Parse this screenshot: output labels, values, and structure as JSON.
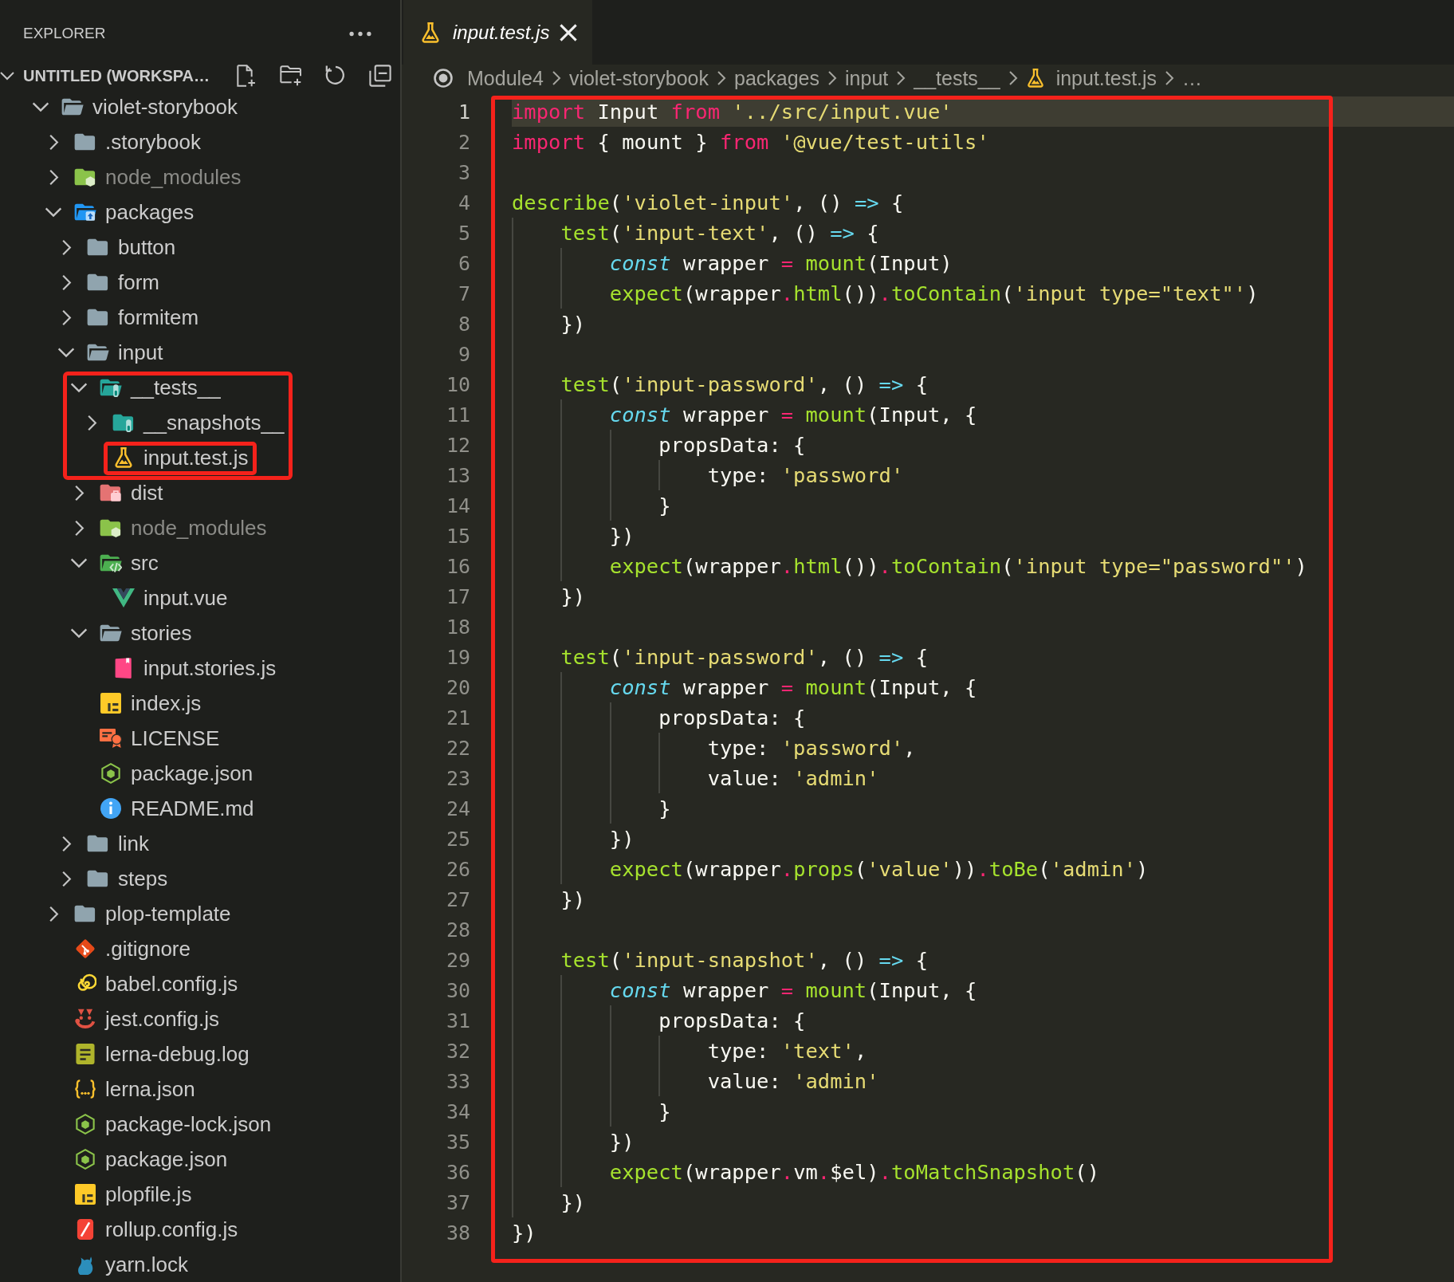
{
  "sidebar": {
    "title": "EXPLORER",
    "workspace": {
      "title": "UNTITLED (WORKSPA…",
      "expanded": true
    },
    "tree": [
      {
        "label": "violet-storybook",
        "kind": "folder",
        "expanded": true,
        "dimmed": false,
        "highlighted": false,
        "children": [
          {
            "label": ".storybook",
            "kind": "folder",
            "expanded": false,
            "dimmed": false,
            "highlighted": false
          },
          {
            "label": "node_modules",
            "kind": "modules",
            "expanded": false,
            "dimmed": true,
            "highlighted": false
          },
          {
            "label": "packages",
            "kind": "packages",
            "expanded": true,
            "dimmed": false,
            "highlighted": false,
            "children": [
              {
                "label": "button",
                "kind": "folder",
                "expanded": false,
                "dimmed": false,
                "highlighted": false
              },
              {
                "label": "form",
                "kind": "folder",
                "expanded": false,
                "dimmed": false,
                "highlighted": false
              },
              {
                "label": "formitem",
                "kind": "folder",
                "expanded": false,
                "dimmed": false,
                "highlighted": false
              },
              {
                "label": "input",
                "kind": "folder",
                "expanded": true,
                "dimmed": false,
                "highlighted": false,
                "children": [
                  {
                    "label": "__tests__",
                    "kind": "tests",
                    "expanded": true,
                    "dimmed": false,
                    "highlighted": true,
                    "children": [
                      {
                        "label": "__snapshots__",
                        "kind": "tests",
                        "expanded": false,
                        "dimmed": false,
                        "highlighted": false
                      },
                      {
                        "label": "input.test.js",
                        "kind": "test",
                        "dimmed": false,
                        "highlighted": true
                      }
                    ]
                  },
                  {
                    "label": "dist",
                    "kind": "dist",
                    "expanded": false,
                    "dimmed": false,
                    "highlighted": false
                  },
                  {
                    "label": "node_modules",
                    "kind": "modules",
                    "expanded": false,
                    "dimmed": true,
                    "highlighted": false
                  },
                  {
                    "label": "src",
                    "kind": "src",
                    "expanded": true,
                    "dimmed": false,
                    "highlighted": false,
                    "children": [
                      {
                        "label": "input.vue",
                        "kind": "vue",
                        "dimmed": false,
                        "highlighted": false
                      }
                    ]
                  },
                  {
                    "label": "stories",
                    "kind": "folder",
                    "expanded": true,
                    "dimmed": false,
                    "highlighted": false,
                    "children": [
                      {
                        "label": "input.stories.js",
                        "kind": "story",
                        "dimmed": false,
                        "highlighted": false
                      }
                    ]
                  },
                  {
                    "label": "index.js",
                    "kind": "js",
                    "dimmed": false,
                    "highlighted": false
                  },
                  {
                    "label": "LICENSE",
                    "kind": "license",
                    "dimmed": false,
                    "highlighted": false
                  },
                  {
                    "label": "package.json",
                    "kind": "node",
                    "dimmed": false,
                    "highlighted": false
                  },
                  {
                    "label": "README.md",
                    "kind": "info",
                    "dimmed": false,
                    "highlighted": false
                  }
                ]
              },
              {
                "label": "link",
                "kind": "folder",
                "expanded": false,
                "dimmed": false,
                "highlighted": false
              },
              {
                "label": "steps",
                "kind": "folder",
                "expanded": false,
                "dimmed": false,
                "highlighted": false
              }
            ]
          },
          {
            "label": "plop-template",
            "kind": "folder",
            "expanded": false,
            "dimmed": false,
            "highlighted": false
          },
          {
            "label": ".gitignore",
            "kind": "git",
            "dimmed": false,
            "highlighted": false
          },
          {
            "label": "babel.config.js",
            "kind": "babel",
            "dimmed": false,
            "highlighted": false
          },
          {
            "label": "jest.config.js",
            "kind": "jest",
            "dimmed": false,
            "highlighted": false
          },
          {
            "label": "lerna-debug.log",
            "kind": "log",
            "dimmed": false,
            "highlighted": false
          },
          {
            "label": "lerna.json",
            "kind": "json",
            "dimmed": false,
            "highlighted": false
          },
          {
            "label": "package-lock.json",
            "kind": "node",
            "dimmed": false,
            "highlighted": false
          },
          {
            "label": "package.json",
            "kind": "node",
            "dimmed": false,
            "highlighted": false
          },
          {
            "label": "plopfile.js",
            "kind": "js",
            "dimmed": false,
            "highlighted": false
          },
          {
            "label": "rollup.config.js",
            "kind": "rollup",
            "dimmed": false,
            "highlighted": false
          },
          {
            "label": "yarn.lock",
            "kind": "yarn",
            "dimmed": false,
            "highlighted": false
          }
        ]
      }
    ]
  },
  "editor": {
    "tabs": [
      {
        "label": "input.test.js",
        "kind": "test",
        "selected": true,
        "preview": true
      }
    ],
    "breadcrumbs": [
      {
        "label": "Module4",
        "kind": "root"
      },
      {
        "label": "violet-storybook",
        "kind": "folder"
      },
      {
        "label": "packages",
        "kind": "folder"
      },
      {
        "label": "input",
        "kind": "folder"
      },
      {
        "label": "__tests__",
        "kind": "folder"
      },
      {
        "label": "input.test.js",
        "kind": "test"
      },
      {
        "label": "…",
        "kind": "symbol"
      }
    ],
    "highlighted": true,
    "lines": [
      {
        "number": "1",
        "current": true,
        "tokens": [
          {
            "kind": "keyword",
            "text": "import"
          },
          {
            "kind": "plain",
            "text": " Input "
          },
          {
            "kind": "keyword",
            "text": "from"
          },
          {
            "kind": "string",
            "text": " '../src/input.vue'"
          }
        ]
      },
      {
        "number": "2",
        "current": false,
        "tokens": [
          {
            "kind": "keyword",
            "text": "import"
          },
          {
            "kind": "plain",
            "text": " { mount } "
          },
          {
            "kind": "keyword",
            "text": "from"
          },
          {
            "kind": "string",
            "text": " '@vue/test-utils'"
          }
        ]
      },
      {
        "number": "3",
        "current": false
      },
      {
        "number": "4",
        "current": false,
        "tokens": [
          {
            "kind": "function",
            "text": "describe"
          },
          {
            "kind": "plain",
            "text": "("
          },
          {
            "kind": "string",
            "text": "'violet-input'"
          },
          {
            "kind": "plain",
            "text": ", () "
          },
          {
            "kind": "arrow",
            "text": "=>"
          },
          {
            "kind": "plain",
            "text": " {"
          }
        ]
      },
      {
        "number": "5",
        "current": false,
        "tokens": [
          {
            "kind": "function",
            "text": "    test"
          },
          {
            "kind": "plain",
            "text": "("
          },
          {
            "kind": "string",
            "text": "'input-text'"
          },
          {
            "kind": "plain",
            "text": ", () "
          },
          {
            "kind": "arrow",
            "text": "=>"
          },
          {
            "kind": "plain",
            "text": " {"
          }
        ]
      },
      {
        "number": "6",
        "current": false,
        "tokens": [
          {
            "kind": "storage",
            "text": "        const"
          },
          {
            "kind": "plain",
            "text": " wrapper "
          },
          {
            "kind": "operator",
            "text": "="
          },
          {
            "kind": "function",
            "text": " mount"
          },
          {
            "kind": "plain",
            "text": "(Input)"
          }
        ]
      },
      {
        "number": "7",
        "current": false,
        "tokens": [
          {
            "kind": "function",
            "text": "        expect"
          },
          {
            "kind": "plain",
            "text": "(wrapper"
          },
          {
            "kind": "operator",
            "text": "."
          },
          {
            "kind": "function",
            "text": "html"
          },
          {
            "kind": "plain",
            "text": "())"
          },
          {
            "kind": "operator",
            "text": "."
          },
          {
            "kind": "function",
            "text": "toContain"
          },
          {
            "kind": "plain",
            "text": "("
          },
          {
            "kind": "string",
            "text": "'input type=\"text\"'"
          },
          {
            "kind": "plain",
            "text": ")"
          }
        ]
      },
      {
        "number": "8",
        "current": false,
        "tokens": [
          {
            "kind": "plain",
            "text": "    })"
          }
        ]
      },
      {
        "number": "9",
        "current": false
      },
      {
        "number": "10",
        "current": false,
        "tokens": [
          {
            "kind": "function",
            "text": "    test"
          },
          {
            "kind": "plain",
            "text": "("
          },
          {
            "kind": "string",
            "text": "'input-password'"
          },
          {
            "kind": "plain",
            "text": ", () "
          },
          {
            "kind": "arrow",
            "text": "=>"
          },
          {
            "kind": "plain",
            "text": " {"
          }
        ]
      },
      {
        "number": "11",
        "current": false,
        "tokens": [
          {
            "kind": "storage",
            "text": "        const"
          },
          {
            "kind": "plain",
            "text": " wrapper "
          },
          {
            "kind": "operator",
            "text": "="
          },
          {
            "kind": "function",
            "text": " mount"
          },
          {
            "kind": "plain",
            "text": "(Input, {"
          }
        ]
      },
      {
        "number": "12",
        "current": false,
        "tokens": [
          {
            "kind": "plain",
            "text": "            propsData: {"
          }
        ]
      },
      {
        "number": "13",
        "current": false,
        "tokens": [
          {
            "kind": "plain",
            "text": "                type: "
          },
          {
            "kind": "string",
            "text": "'password'"
          }
        ]
      },
      {
        "number": "14",
        "current": false,
        "tokens": [
          {
            "kind": "plain",
            "text": "            }"
          }
        ]
      },
      {
        "number": "15",
        "current": false,
        "tokens": [
          {
            "kind": "plain",
            "text": "        })"
          }
        ]
      },
      {
        "number": "16",
        "current": false,
        "tokens": [
          {
            "kind": "function",
            "text": "        expect"
          },
          {
            "kind": "plain",
            "text": "(wrapper"
          },
          {
            "kind": "operator",
            "text": "."
          },
          {
            "kind": "function",
            "text": "html"
          },
          {
            "kind": "plain",
            "text": "())"
          },
          {
            "kind": "operator",
            "text": "."
          },
          {
            "kind": "function",
            "text": "toContain"
          },
          {
            "kind": "plain",
            "text": "("
          },
          {
            "kind": "string",
            "text": "'input type=\"password\"'"
          },
          {
            "kind": "plain",
            "text": ")"
          }
        ]
      },
      {
        "number": "17",
        "current": false,
        "tokens": [
          {
            "kind": "plain",
            "text": "    })"
          }
        ]
      },
      {
        "number": "18",
        "current": false
      },
      {
        "number": "19",
        "current": false,
        "tokens": [
          {
            "kind": "function",
            "text": "    test"
          },
          {
            "kind": "plain",
            "text": "("
          },
          {
            "kind": "string",
            "text": "'input-password'"
          },
          {
            "kind": "plain",
            "text": ", () "
          },
          {
            "kind": "arrow",
            "text": "=>"
          },
          {
            "kind": "plain",
            "text": " {"
          }
        ]
      },
      {
        "number": "20",
        "current": false,
        "tokens": [
          {
            "kind": "storage",
            "text": "        const"
          },
          {
            "kind": "plain",
            "text": " wrapper "
          },
          {
            "kind": "operator",
            "text": "="
          },
          {
            "kind": "function",
            "text": " mount"
          },
          {
            "kind": "plain",
            "text": "(Input, {"
          }
        ]
      },
      {
        "number": "21",
        "current": false,
        "tokens": [
          {
            "kind": "plain",
            "text": "            propsData: {"
          }
        ]
      },
      {
        "number": "22",
        "current": false,
        "tokens": [
          {
            "kind": "plain",
            "text": "                type: "
          },
          {
            "kind": "string",
            "text": "'password'"
          },
          {
            "kind": "plain",
            "text": ","
          }
        ]
      },
      {
        "number": "23",
        "current": false,
        "tokens": [
          {
            "kind": "plain",
            "text": "                value: "
          },
          {
            "kind": "string",
            "text": "'admin'"
          }
        ]
      },
      {
        "number": "24",
        "current": false,
        "tokens": [
          {
            "kind": "plain",
            "text": "            }"
          }
        ]
      },
      {
        "number": "25",
        "current": false,
        "tokens": [
          {
            "kind": "plain",
            "text": "        })"
          }
        ]
      },
      {
        "number": "26",
        "current": false,
        "tokens": [
          {
            "kind": "function",
            "text": "        expect"
          },
          {
            "kind": "plain",
            "text": "(wrapper"
          },
          {
            "kind": "operator",
            "text": "."
          },
          {
            "kind": "function",
            "text": "props"
          },
          {
            "kind": "plain",
            "text": "("
          },
          {
            "kind": "string",
            "text": "'value'"
          },
          {
            "kind": "plain",
            "text": "))"
          },
          {
            "kind": "operator",
            "text": "."
          },
          {
            "kind": "function",
            "text": "toBe"
          },
          {
            "kind": "plain",
            "text": "("
          },
          {
            "kind": "string",
            "text": "'admin'"
          },
          {
            "kind": "plain",
            "text": ")"
          }
        ]
      },
      {
        "number": "27",
        "current": false,
        "tokens": [
          {
            "kind": "plain",
            "text": "    })"
          }
        ]
      },
      {
        "number": "28",
        "current": false
      },
      {
        "number": "29",
        "current": false,
        "tokens": [
          {
            "kind": "function",
            "text": "    test"
          },
          {
            "kind": "plain",
            "text": "("
          },
          {
            "kind": "string",
            "text": "'input-snapshot'"
          },
          {
            "kind": "plain",
            "text": ", () "
          },
          {
            "kind": "arrow",
            "text": "=>"
          },
          {
            "kind": "plain",
            "text": " {"
          }
        ]
      },
      {
        "number": "30",
        "current": false,
        "tokens": [
          {
            "kind": "storage",
            "text": "        const"
          },
          {
            "kind": "plain",
            "text": " wrapper "
          },
          {
            "kind": "operator",
            "text": "="
          },
          {
            "kind": "function",
            "text": " mount"
          },
          {
            "kind": "plain",
            "text": "(Input, {"
          }
        ]
      },
      {
        "number": "31",
        "current": false,
        "tokens": [
          {
            "kind": "plain",
            "text": "            propsData: {"
          }
        ]
      },
      {
        "number": "32",
        "current": false,
        "tokens": [
          {
            "kind": "plain",
            "text": "                type: "
          },
          {
            "kind": "string",
            "text": "'text'"
          },
          {
            "kind": "plain",
            "text": ","
          }
        ]
      },
      {
        "number": "33",
        "current": false,
        "tokens": [
          {
            "kind": "plain",
            "text": "                value: "
          },
          {
            "kind": "string",
            "text": "'admin'"
          }
        ]
      },
      {
        "number": "34",
        "current": false,
        "tokens": [
          {
            "kind": "plain",
            "text": "            }"
          }
        ]
      },
      {
        "number": "35",
        "current": false,
        "tokens": [
          {
            "kind": "plain",
            "text": "        })"
          }
        ]
      },
      {
        "number": "36",
        "current": false,
        "tokens": [
          {
            "kind": "function",
            "text": "        expect"
          },
          {
            "kind": "plain",
            "text": "(wrapper"
          },
          {
            "kind": "operator",
            "text": "."
          },
          {
            "kind": "plain",
            "text": "vm"
          },
          {
            "kind": "operator",
            "text": "."
          },
          {
            "kind": "plain",
            "text": "$el)"
          },
          {
            "kind": "operator",
            "text": "."
          },
          {
            "kind": "function",
            "text": "toMatchSnapshot"
          },
          {
            "kind": "plain",
            "text": "()"
          }
        ]
      },
      {
        "number": "37",
        "current": false,
        "tokens": [
          {
            "kind": "plain",
            "text": "    })"
          }
        ]
      },
      {
        "number": "38",
        "current": false,
        "tokens": [
          {
            "kind": "plain",
            "text": "})"
          }
        ]
      }
    ]
  }
}
